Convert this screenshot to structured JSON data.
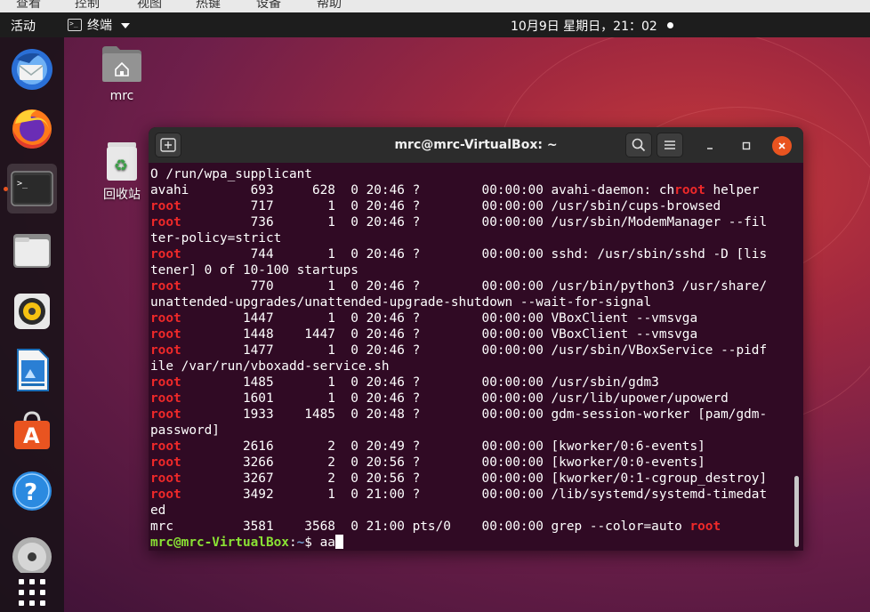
{
  "top_menu": [
    "查看",
    "控制",
    "视图",
    "热键",
    "设备",
    "帮助"
  ],
  "topbar": {
    "activities": "活动",
    "app_menu_label": "终端",
    "clock": "10月9日 星期日，21：02"
  },
  "desktop": {
    "home_label": "mrc",
    "trash_label": "回收站"
  },
  "dock": {
    "items": [
      "thunderbird-icon",
      "firefox-icon",
      "terminal-icon",
      "files-icon",
      "rhythmbox-icon",
      "libreoffice-writer-icon",
      "software-center-icon",
      "help-icon",
      "dvd-icon",
      "show-apps-icon"
    ]
  },
  "terminal": {
    "title": "mrc@mrc-VirtualBox: ~",
    "lines": [
      [
        {
          "t": "O /run/wpa_supplicant"
        }
      ],
      [
        {
          "t": "avahi        693     628  0 20:46 ?        00:00:00 avahi-daemon: ch"
        },
        {
          "t": "root",
          "c": "red"
        },
        {
          "t": " helper"
        }
      ],
      [
        {
          "t": "root",
          "c": "red"
        },
        {
          "t": "         717       1  0 20:46 ?        00:00:00 /usr/sbin/cups-browsed"
        }
      ],
      [
        {
          "t": "root",
          "c": "red"
        },
        {
          "t": "         736       1  0 20:46 ?        00:00:00 /usr/sbin/ModemManager --fil"
        }
      ],
      [
        {
          "t": "ter-policy=strict"
        }
      ],
      [
        {
          "t": "root",
          "c": "red"
        },
        {
          "t": "         744       1  0 20:46 ?        00:00:00 sshd: /usr/sbin/sshd -D [lis"
        }
      ],
      [
        {
          "t": "tener] 0 of 10-100 startups"
        }
      ],
      [
        {
          "t": "root",
          "c": "red"
        },
        {
          "t": "         770       1  0 20:46 ?        00:00:00 /usr/bin/python3 /usr/share/"
        }
      ],
      [
        {
          "t": "unattended-upgrades/unattended-upgrade-shutdown --wait-for-signal"
        }
      ],
      [
        {
          "t": "root",
          "c": "red"
        },
        {
          "t": "        1447       1  0 20:46 ?        00:00:00 VBoxClient --vmsvga"
        }
      ],
      [
        {
          "t": "root",
          "c": "red"
        },
        {
          "t": "        1448    1447  0 20:46 ?        00:00:00 VBoxClient --vmsvga"
        }
      ],
      [
        {
          "t": "root",
          "c": "red"
        },
        {
          "t": "        1477       1  0 20:46 ?        00:00:00 /usr/sbin/VBoxService --pidf"
        }
      ],
      [
        {
          "t": "ile /var/run/vboxadd-service.sh"
        }
      ],
      [
        {
          "t": "root",
          "c": "red"
        },
        {
          "t": "        1485       1  0 20:46 ?        00:00:00 /usr/sbin/gdm3"
        }
      ],
      [
        {
          "t": "root",
          "c": "red"
        },
        {
          "t": "        1601       1  0 20:46 ?        00:00:00 /usr/lib/upower/upowerd"
        }
      ],
      [
        {
          "t": "root",
          "c": "red"
        },
        {
          "t": "        1933    1485  0 20:48 ?        00:00:00 gdm-session-worker [pam/gdm-"
        }
      ],
      [
        {
          "t": "password]"
        }
      ],
      [
        {
          "t": "root",
          "c": "red"
        },
        {
          "t": "        2616       2  0 20:49 ?        00:00:00 [kworker/0:6-events]"
        }
      ],
      [
        {
          "t": "root",
          "c": "red"
        },
        {
          "t": "        3266       2  0 20:56 ?        00:00:00 [kworker/0:0-events]"
        }
      ],
      [
        {
          "t": "root",
          "c": "red"
        },
        {
          "t": "        3267       2  0 20:56 ?        00:00:00 [kworker/0:1-cgroup_destroy]"
        }
      ],
      [
        {
          "t": "root",
          "c": "red"
        },
        {
          "t": "        3492       1  0 21:00 ?        00:00:00 /lib/systemd/systemd-timedat"
        }
      ],
      [
        {
          "t": "ed"
        }
      ],
      [
        {
          "t": "mrc         3581    3568  0 21:00 pts/0    00:00:00 grep --color=auto "
        },
        {
          "t": "root",
          "c": "red"
        }
      ],
      [
        {
          "t": "mrc@mrc-VirtualBox",
          "c": "green"
        },
        {
          "t": ":"
        },
        {
          "t": "~",
          "c": "blue"
        },
        {
          "t": "$ aa"
        }
      ]
    ]
  },
  "colors": {
    "terminal_bg": "#300a24",
    "highlight_red": "#ef2929",
    "prompt_green": "#8ae234",
    "prompt_blue": "#729fcf",
    "ubuntu_orange": "#e95420"
  }
}
